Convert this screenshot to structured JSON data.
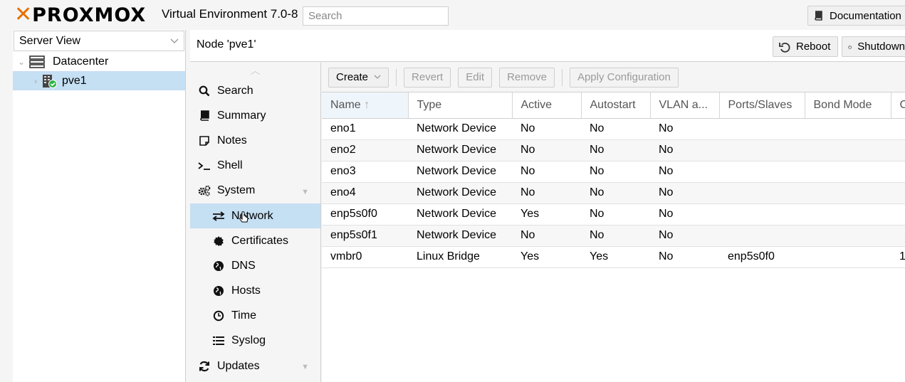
{
  "app": {
    "logo_text": "PROXMOX",
    "version": "Virtual Environment 7.0-8",
    "search_placeholder": "Search",
    "documentation_label": "Documentation"
  },
  "tree": {
    "view_label": "Server View",
    "datacenter_label": "Datacenter",
    "node_label": "pve1"
  },
  "node_header": {
    "title": "Node 'pve1'",
    "reboot_label": "Reboot",
    "shutdown_label": "Shutdown"
  },
  "menu": {
    "items": [
      {
        "label": "Search",
        "icon": "search-icon"
      },
      {
        "label": "Summary",
        "icon": "book-icon"
      },
      {
        "label": "Notes",
        "icon": "note-icon"
      },
      {
        "label": "Shell",
        "icon": "terminal-icon"
      },
      {
        "label": "System",
        "icon": "cogs-icon"
      },
      {
        "label": "Network",
        "icon": "exchange-icon"
      },
      {
        "label": "Certificates",
        "icon": "certificate-icon"
      },
      {
        "label": "DNS",
        "icon": "globe-icon"
      },
      {
        "label": "Hosts",
        "icon": "globe-icon"
      },
      {
        "label": "Time",
        "icon": "clock-icon"
      },
      {
        "label": "Syslog",
        "icon": "list-icon"
      },
      {
        "label": "Updates",
        "icon": "refresh-icon"
      }
    ]
  },
  "toolbar": {
    "create_label": "Create",
    "revert_label": "Revert",
    "edit_label": "Edit",
    "remove_label": "Remove",
    "apply_label": "Apply Configuration"
  },
  "table": {
    "columns": [
      "Name",
      "Type",
      "Active",
      "Autostart",
      "VLAN a...",
      "Ports/Slaves",
      "Bond Mode",
      "C"
    ],
    "rows": [
      [
        "eno1",
        "Network Device",
        "No",
        "No",
        "No",
        "",
        "",
        ""
      ],
      [
        "eno2",
        "Network Device",
        "No",
        "No",
        "No",
        "",
        "",
        ""
      ],
      [
        "eno3",
        "Network Device",
        "No",
        "No",
        "No",
        "",
        "",
        ""
      ],
      [
        "eno4",
        "Network Device",
        "No",
        "No",
        "No",
        "",
        "",
        ""
      ],
      [
        "enp5s0f0",
        "Network Device",
        "Yes",
        "No",
        "No",
        "",
        "",
        ""
      ],
      [
        "enp5s0f1",
        "Network Device",
        "No",
        "No",
        "No",
        "",
        "",
        ""
      ],
      [
        "vmbr0",
        "Linux Bridge",
        "Yes",
        "Yes",
        "No",
        "enp5s0f0",
        "",
        "1"
      ]
    ]
  },
  "colors": {
    "accent": "#e57000",
    "selection": "#c5dff3",
    "status_ok": "#2fb344"
  }
}
